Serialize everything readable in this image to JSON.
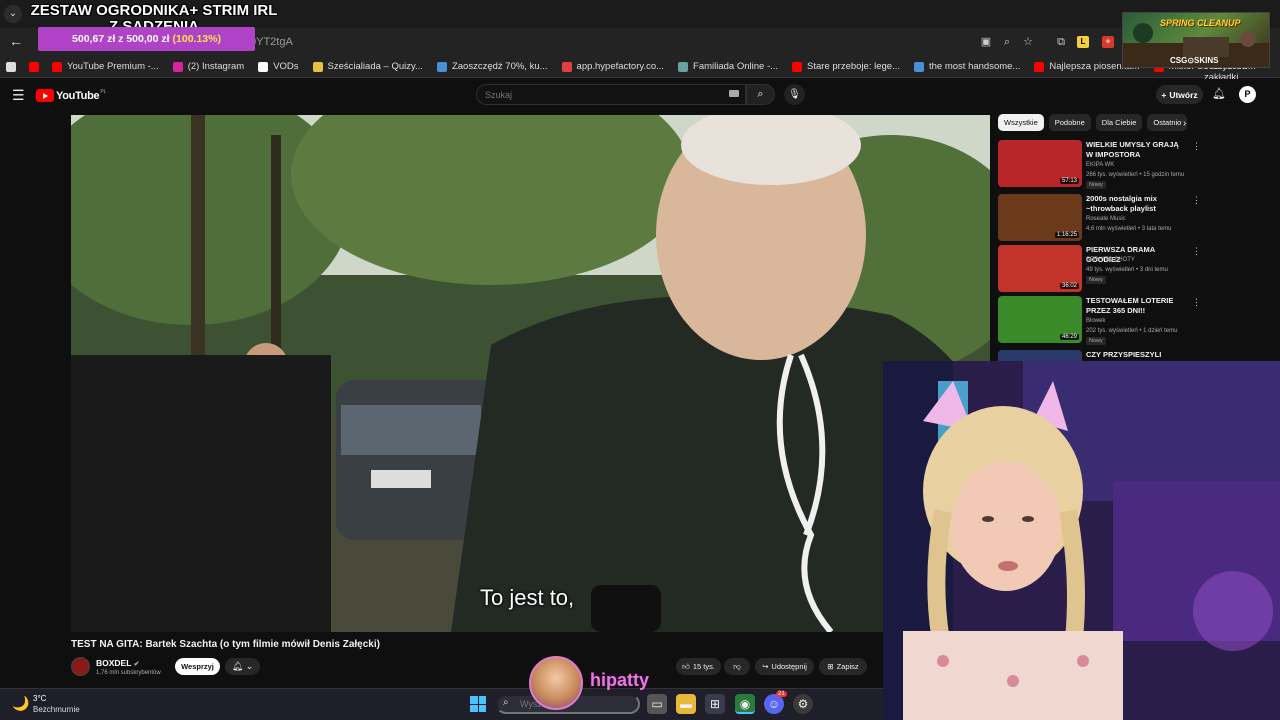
{
  "overlay": {
    "goal_title": "ZESTAW OGRODNIKA+ STRIM IRL Z SADZENIA",
    "goal_amount": "500,67 zł z 500,00 zł",
    "goal_percent": "(100.13%)",
    "ad_title": "SPRING CLEANUP",
    "ad_brand": "CSG⊙SKINS",
    "streamer_name": "hipatty"
  },
  "browser": {
    "tab_menu_icon": "chevron-down",
    "url_fragment": "0YT2tgA",
    "all_bookmarks": "Wszystkie zakładki",
    "bookmarks": [
      {
        "label": "",
        "color": "#dddddd"
      },
      {
        "label": "",
        "color": "#ff0000"
      },
      {
        "label": "YouTube Premium -...",
        "color": "#ff0000"
      },
      {
        "label": "(2) Instagram",
        "color": "#d6249f"
      },
      {
        "label": "VODs",
        "color": "#ffffff"
      },
      {
        "label": "Sześcialiada – Quizy...",
        "color": "#e8c33a"
      },
      {
        "label": "Zaoszczędź 70%, ku...",
        "color": "#4a90d9"
      },
      {
        "label": "app.hypefactory.co...",
        "color": "#e04040"
      },
      {
        "label": "Familiada Online -...",
        "color": "#6aa0a0"
      },
      {
        "label": "Stare przeboje: lege...",
        "color": "#ff0000"
      },
      {
        "label": "the most handsome...",
        "color": "#4a90d9"
      },
      {
        "label": "Najlepsza piosenka...",
        "color": "#ff0000"
      },
      {
        "label": "Mister Streamerów...",
        "color": "#ff0000"
      }
    ]
  },
  "youtube": {
    "logo_text": "YouTube",
    "country": "PL",
    "search_placeholder": "Szukaj",
    "create_label": "Utwórz",
    "avatar_letter": "P",
    "video": {
      "subtitle": "To jest to,",
      "title": "TEST NA GITA: Bartek Szachta (o tym filmie mówił Denis Załęcki)",
      "channel": "BOXDEL",
      "subscribers": "1,76 mln subskrybentów",
      "support_label": "Wesprzyj",
      "likes": "15 tys.",
      "share_label": "Udostępnij",
      "save_label": "Zapisz"
    },
    "chips": [
      "Wszystkie",
      "Podobne",
      "Dla Ciebie",
      "Ostatnio"
    ],
    "recommendations": [
      {
        "title": "WIELKIE UMYSŁY GRAJĄ W IMPOSTORA",
        "channel": "EKIPA WK",
        "meta": "266 tys. wyświetleń • 15 godzin temu",
        "badge": "Nowy",
        "duration": "57:13",
        "color": "#b8262a"
      },
      {
        "title": "2000s nostalgia mix ~throwback playlist",
        "channel": "Roseate Music",
        "meta": "4,6 mln wyświetleń • 3 lata temu",
        "badge": "",
        "duration": "1:16:25",
        "color": "#6a3a1a"
      },
      {
        "title": "PIERWSZA DRAMA GOODIEZ",
        "channel": "SERHITO SHOTY",
        "meta": "49 tys. wyświetleń • 3 dni temu",
        "badge": "Nowy",
        "duration": "36:02",
        "color": "#c2342a"
      },
      {
        "title": "TESTOWAŁEM LOTERIE PRZEZ 365 DNI!!",
        "channel": "Blowek",
        "meta": "202 tys. wyświetleń • 1 dzień temu",
        "badge": "Nowy",
        "duration": "46:29",
        "color": "#3a8a2a"
      },
      {
        "title": "CZY PRZYSPIESZYLI CZAS?",
        "channel": "",
        "meta": "",
        "badge": "",
        "duration": "",
        "color": "#2a3a6a"
      }
    ]
  },
  "taskbar": {
    "temperature": "3°C",
    "weather": "Bezchmurnie",
    "search_placeholder": "Wyszukaj",
    "discord_badge": "21"
  }
}
